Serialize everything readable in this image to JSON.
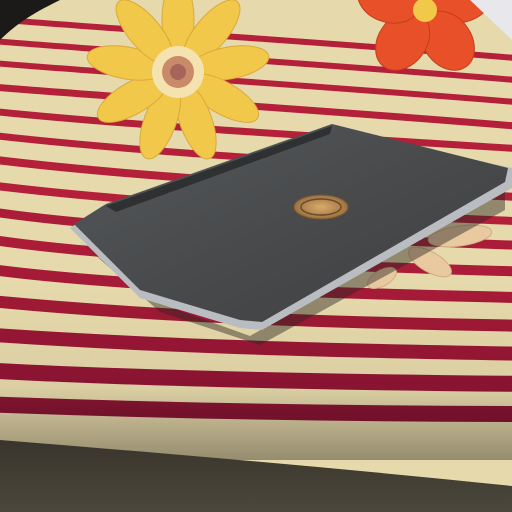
{
  "scene": {
    "subject": "closed-laptop-on-striped-floral-bedspread",
    "colors": {
      "fabric_base": "#e9dcae",
      "stripe_red": "#b41f3a",
      "stripe_deep": "#8a1533",
      "flower_yellow": "#f2c84a",
      "flower_orange": "#e8502a",
      "laptop_lid": "#4a4c4e",
      "laptop_edge": "#b9bcc0",
      "logo_gold": "#c89a5a",
      "floor_shadow": "#2f2b24"
    },
    "icons": [
      "dell-logo-icon",
      "sunflower-pattern-icon",
      "orange-flower-pattern-icon"
    ]
  }
}
